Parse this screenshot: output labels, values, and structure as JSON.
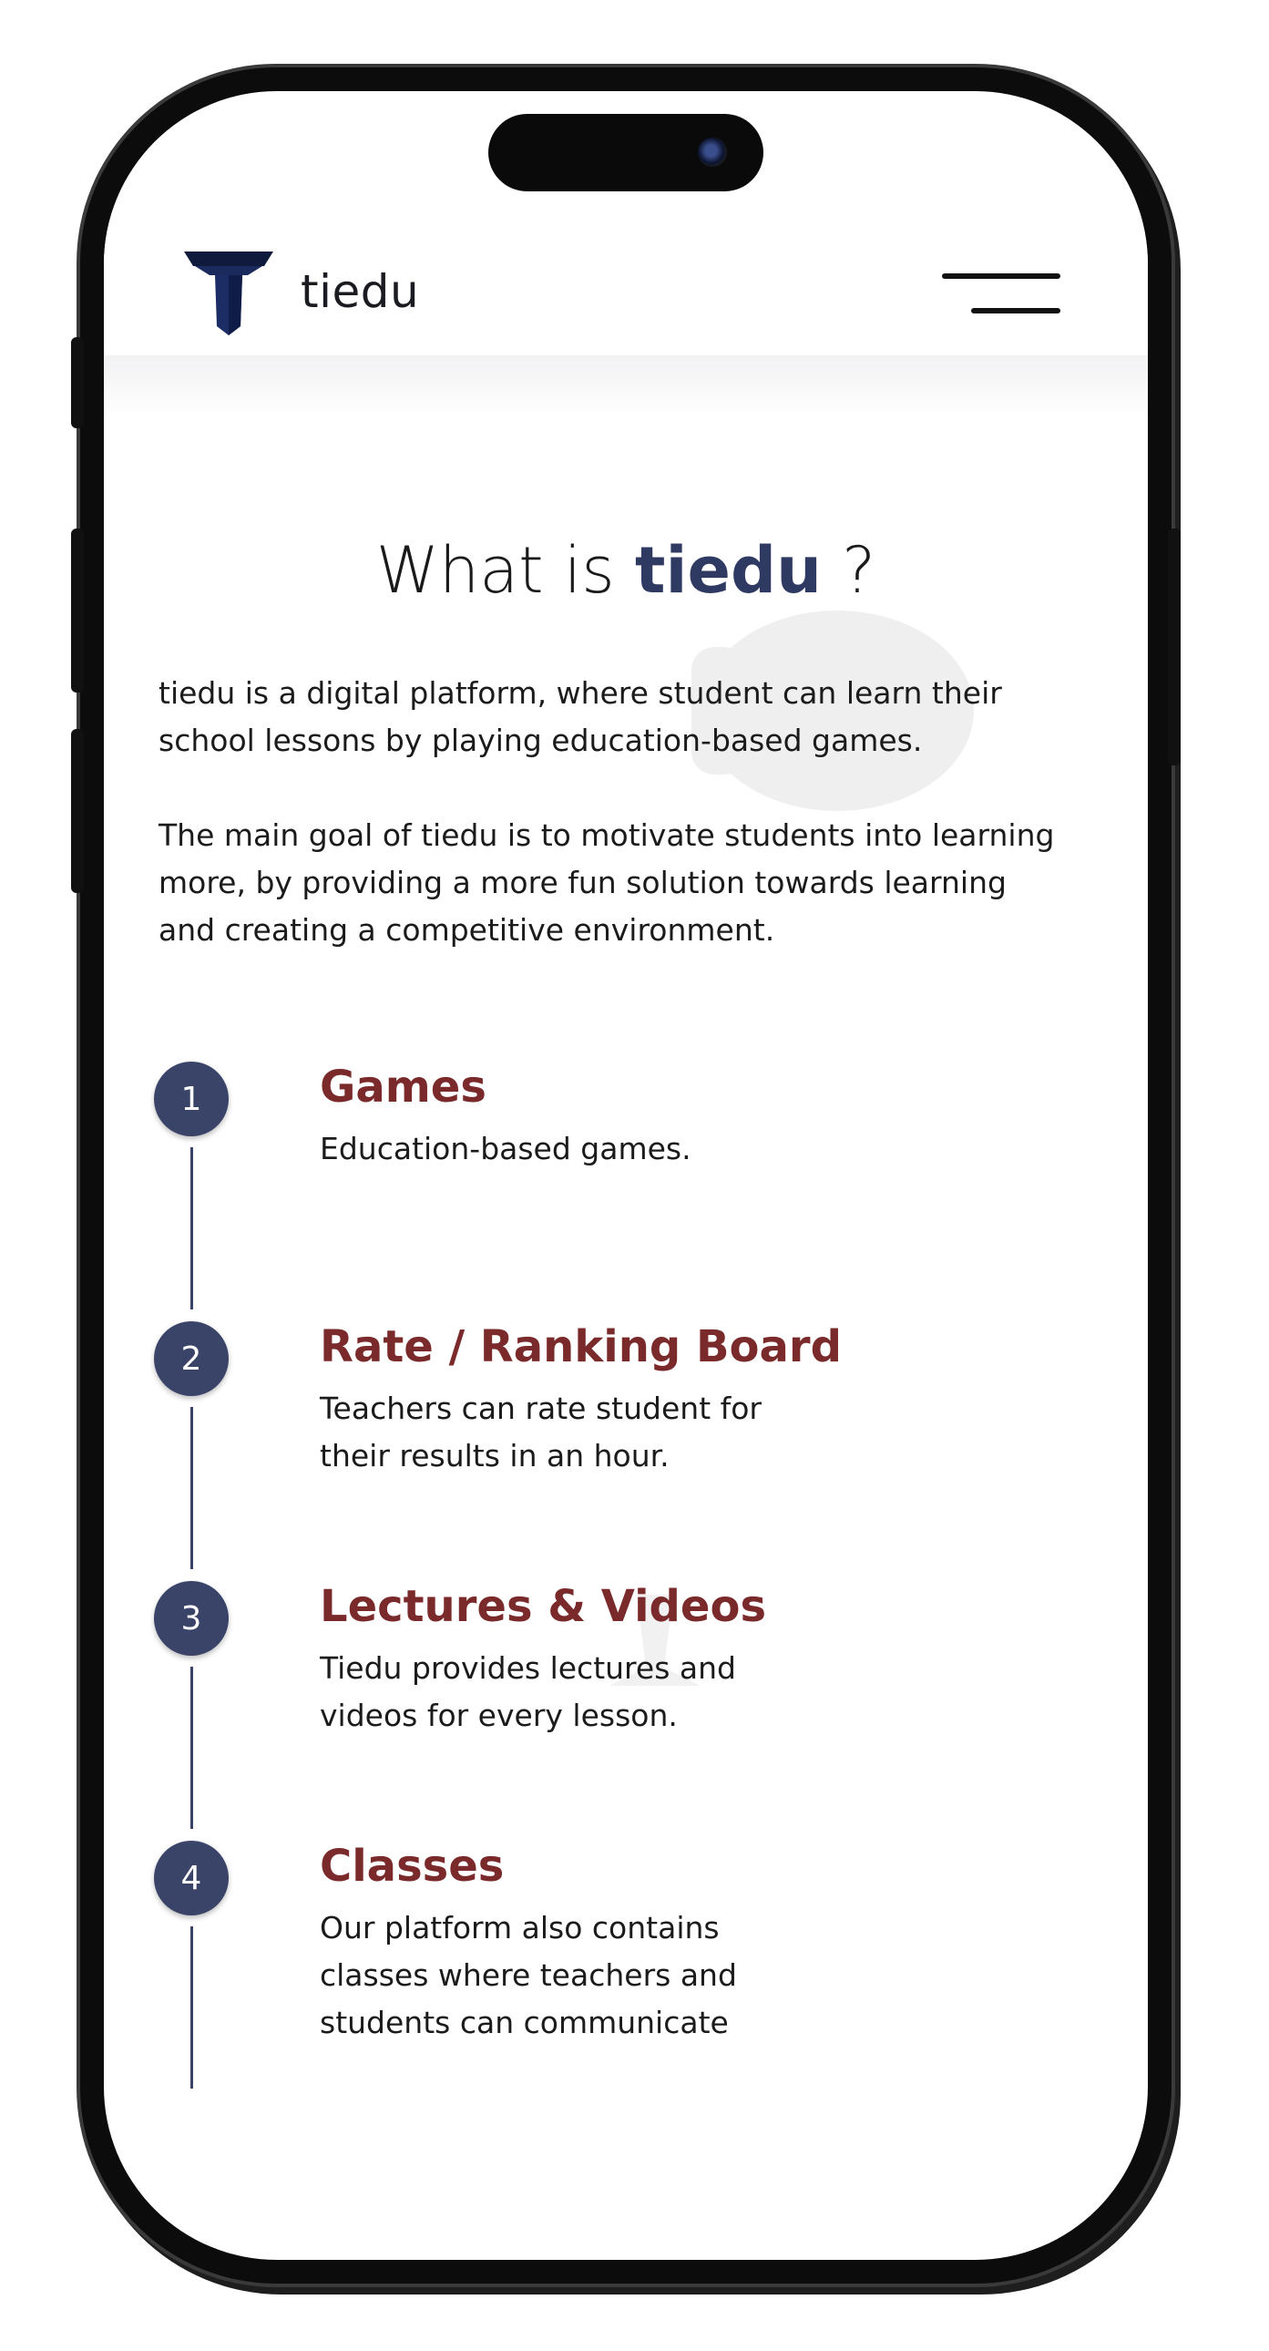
{
  "header": {
    "logo_text": "tiedu",
    "logo_icon": "graduation-cap-icon",
    "menu_icon": "hamburger-menu-icon"
  },
  "about": {
    "title_prefix": "What is ",
    "title_brand": "tiedu",
    "title_suffix": " ?",
    "paragraphs": [
      "tiedu is a digital platform, where student can learn their school lessons by playing education-based games.",
      "The main goal of tiedu is to motivate students into learning more, by providing a more fun solution towards learning and creating a competitive environment."
    ]
  },
  "features": [
    {
      "number": "1",
      "title": "Games",
      "description": "Education-based games."
    },
    {
      "number": "2",
      "title": "Rate / Ranking Board",
      "description": "Teachers can rate student for their results in an hour."
    },
    {
      "number": "3",
      "title": "Lectures & Videos",
      "description": "Tiedu provides lectures and videos for every lesson."
    },
    {
      "number": "4",
      "title": "Classes",
      "description": "Our platform also contains classes where teachers and students can communicate"
    }
  ],
  "colors": {
    "brand_navy": "#2f3a63",
    "timeline_circle": "#3a4468",
    "feature_title": "#7a2a2a",
    "text": "#1b1b1b"
  }
}
